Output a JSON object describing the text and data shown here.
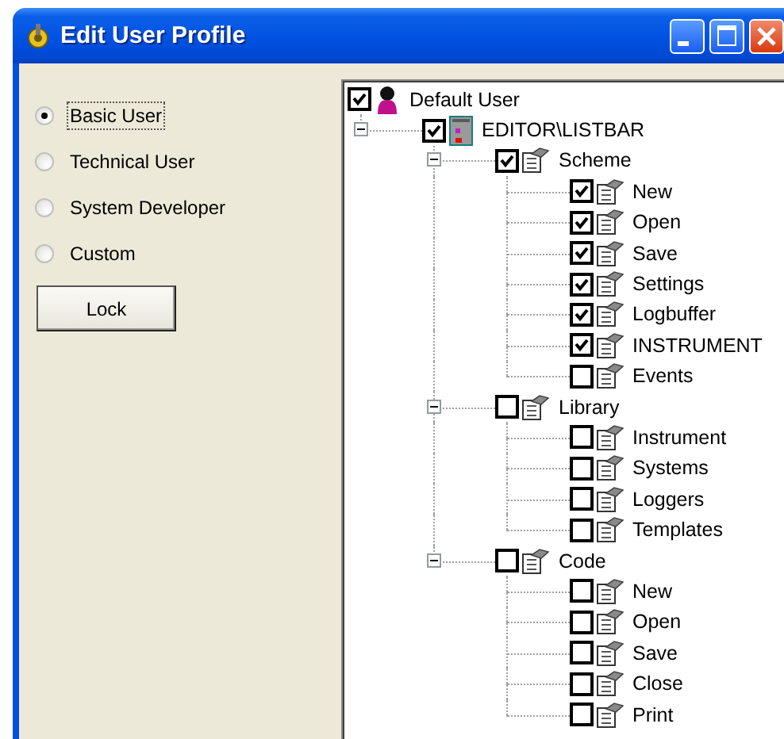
{
  "window": {
    "title": "Edit User Profile"
  },
  "user_levels": [
    {
      "label": "Basic User",
      "selected": true,
      "focused": true
    },
    {
      "label": "Technical User",
      "selected": false,
      "focused": false
    },
    {
      "label": "System Developer",
      "selected": false,
      "focused": false
    },
    {
      "label": "Custom",
      "selected": false,
      "focused": false
    }
  ],
  "lock_button": "Lock",
  "tree": {
    "label": "Default User",
    "kind": "user",
    "checked": true,
    "children": [
      {
        "label": "EDITOR\\LISTBAR",
        "kind": "device",
        "checked": true,
        "expanded": true,
        "children": [
          {
            "label": "Scheme",
            "kind": "module",
            "checked": true,
            "expanded": true,
            "children": [
              {
                "label": "New",
                "kind": "module",
                "checked": true
              },
              {
                "label": "Open",
                "kind": "module",
                "checked": true
              },
              {
                "label": "Save",
                "kind": "module",
                "checked": true
              },
              {
                "label": "Settings",
                "kind": "module",
                "checked": true
              },
              {
                "label": "Logbuffer",
                "kind": "module",
                "checked": true
              },
              {
                "label": "INSTRUMENT",
                "kind": "module",
                "checked": true
              },
              {
                "label": "Events",
                "kind": "module",
                "checked": false
              }
            ]
          },
          {
            "label": "Library",
            "kind": "module",
            "checked": false,
            "expanded": true,
            "children": [
              {
                "label": "Instrument",
                "kind": "module",
                "checked": false
              },
              {
                "label": "Systems",
                "kind": "module",
                "checked": false
              },
              {
                "label": "Loggers",
                "kind": "module",
                "checked": false
              },
              {
                "label": "Templates",
                "kind": "module",
                "checked": false
              }
            ]
          },
          {
            "label": "Code",
            "kind": "module",
            "checked": false,
            "expanded": true,
            "children": [
              {
                "label": "New",
                "kind": "module",
                "checked": false
              },
              {
                "label": "Open",
                "kind": "module",
                "checked": false
              },
              {
                "label": "Save",
                "kind": "module",
                "checked": false
              },
              {
                "label": "Close",
                "kind": "module",
                "checked": false
              },
              {
                "label": "Print",
                "kind": "module",
                "checked": false
              }
            ]
          }
        ]
      }
    ]
  }
}
